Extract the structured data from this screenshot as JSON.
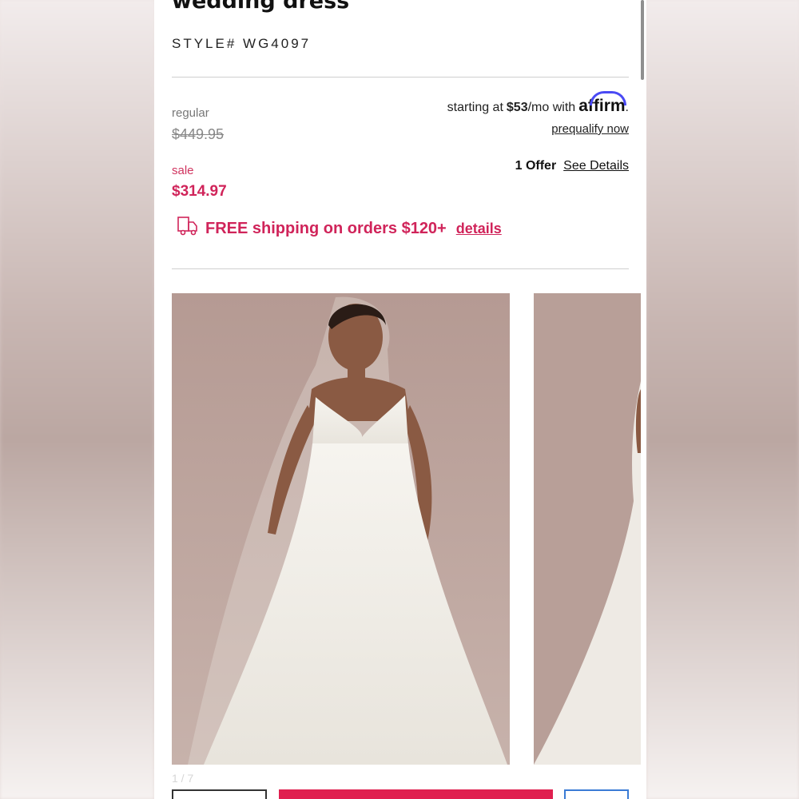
{
  "product": {
    "title": "wedding dress",
    "style": "STYLE# WG4097"
  },
  "pricing": {
    "regular_label": "regular",
    "regular_price": "$449.95",
    "sale_label": "sale",
    "sale_price": "$314.97"
  },
  "affirm": {
    "prefix": "starting at",
    "amount": "$53",
    "suffix": "/mo with",
    "brand": "affirm",
    "period": ".",
    "prequalify": "prequalify now"
  },
  "offers": {
    "count": "1 Offer",
    "link": "See Details"
  },
  "shipping": {
    "text": "FREE shipping on orders $120+",
    "link": "details",
    "icon": "shipping-truck-icon"
  },
  "gallery": {
    "pager": "1 / 7"
  },
  "colors": {
    "accent": "#d0245a",
    "affirm_arc": "#4a4af4",
    "photo_backdrop": "#b79c95"
  }
}
